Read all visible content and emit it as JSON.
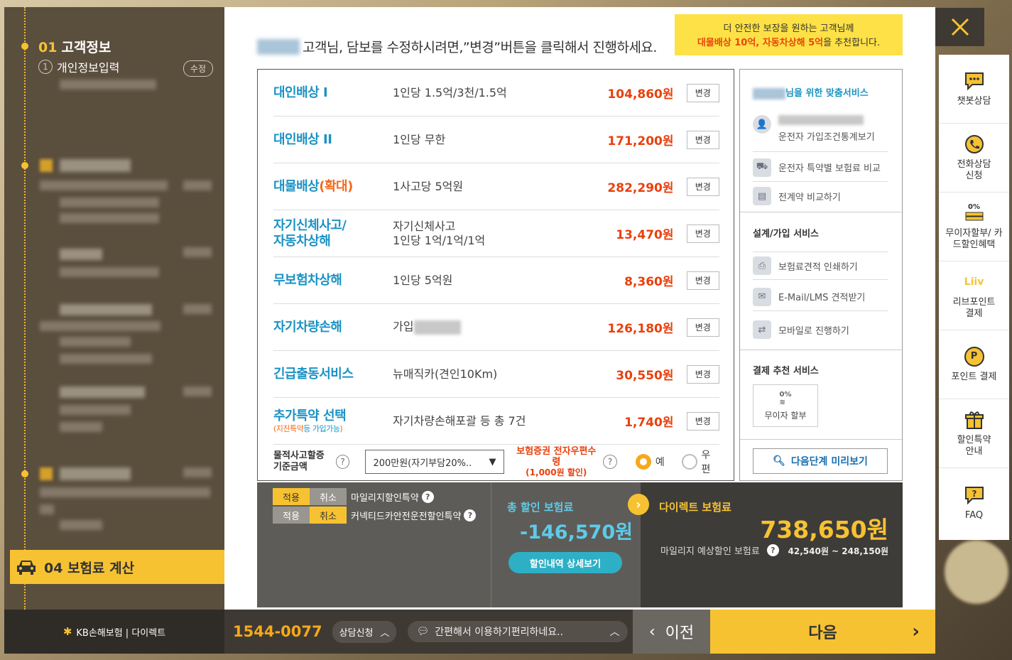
{
  "sidebar": {
    "step1": {
      "num": "01",
      "title": "고객정보"
    },
    "sub1": {
      "num": "1",
      "label": "개인정보입력",
      "edit": "수정"
    },
    "step4": {
      "num": "04",
      "title": "보험료 계산"
    }
  },
  "headline": {
    "text": "고객님, 담보를 수정하시려면,”변경”버튼을 클릭해서 진행하세요."
  },
  "promo": {
    "line1": "더 안전한 보장을 원하는 고객님께",
    "highlight": "대물배상 10억, 자동차상해 5억",
    "line2_suffix": "을 추천합니다."
  },
  "coverages": [
    {
      "name": "대인배상 I",
      "desc": "1인당 1.5억/3천/1.5억",
      "price": "104,860원",
      "btn": "변경"
    },
    {
      "name": "대인배상 II",
      "desc": "1인당 무한",
      "price": "171,200원",
      "btn": "변경"
    },
    {
      "name": "대물배상",
      "name_extra": "(확대)",
      "desc": "1사고당 5억원",
      "price": "282,290원",
      "btn": "변경"
    },
    {
      "name": "자기신체사고/",
      "name2": "자동차상해",
      "desc": "자기신체사고",
      "desc2": "1인당 1억/1억/1억",
      "price": "13,470원",
      "btn": "변경"
    },
    {
      "name": "무보험차상해",
      "desc": "1인당 5억원",
      "price": "8,360원",
      "btn": "변경"
    },
    {
      "name": "자기차량손해",
      "desc": "가입",
      "price": "126,180원",
      "btn": "변경"
    },
    {
      "name": "긴급출동서비스",
      "desc": "뉴매직카(견인10Km)",
      "price": "30,550원",
      "btn": "변경"
    },
    {
      "name": "추가특약 선택",
      "name_sub_orange": "지진특약",
      "name_sub_rest": "등 가입가능",
      "desc": "자기차량손해포괄 등 총 7건",
      "price": "1,740원",
      "btn": "변경"
    }
  ],
  "accident": {
    "label": "물적사고할증 기준금액",
    "select_value": "200만원(자기부담20%..",
    "ecert_label": "보험증권 전자우편수령",
    "ecert_sub": "(1,000원 할인)",
    "opt_yes": "예",
    "opt_mail": "우편"
  },
  "services": {
    "custom_title": "님을 위한 맞춤서비스",
    "driver_stats": "운전자 가입조건통계보기",
    "rider_compare": "운전자 특약별 보험료 비교",
    "prev_contract": "전계약 비교하기",
    "design_title": "설계/가입 서비스",
    "print_quote": "보험료견적 인쇄하기",
    "email_quote": "E-Mail/LMS 견적받기",
    "mobile": "모바일로 진행하기",
    "pay_title": "결제 추천 서비스",
    "no_interest": "무이자 할부",
    "no_interest_badge": "0%",
    "preview": "다음단계 미리보기"
  },
  "discounts": {
    "apply": "적용",
    "cancel": "취소",
    "mileage": "마일리지할인특약",
    "connected": "커넥티드카안전운전할인특약",
    "total_label": "총 할인 보험료",
    "total_value": "-146,570원",
    "detail_btn": "할인내역 상세보기",
    "direct_label": "다이렉트 보험료",
    "direct_value": "738,650원",
    "mile_label": "마일리지 예상할인 보험료",
    "mile_range": "42,540원 ~ 248,150원"
  },
  "rail": [
    {
      "label": "챗봇상담",
      "icon": "chatbot-icon"
    },
    {
      "label": "전화상담 신청",
      "icon": "phone-icon"
    },
    {
      "label": "무이자할부/ 카드할인혜택",
      "icon": "card-icon",
      "badge": "0%"
    },
    {
      "label": "리브포인트 결제",
      "icon": "liiv-icon",
      "badge": "Liiv"
    },
    {
      "label": "포인트 결제",
      "icon": "point-icon",
      "badge": "P"
    },
    {
      "label": "할인특약 안내",
      "icon": "gift-icon"
    },
    {
      "label": "FAQ",
      "icon": "faq-icon"
    }
  ],
  "bottom": {
    "logo": "KB손해보험 | 다이렉트",
    "phone": "1544-0077",
    "consult": "상담신청",
    "chat": "간편해서 이용하기편리하네요..",
    "prev": "이전",
    "next": "다음"
  },
  "colors": {
    "accent": "#f7c232",
    "blue": "#1a92c4",
    "price": "#e8400c",
    "dark": "#3e3a33"
  }
}
